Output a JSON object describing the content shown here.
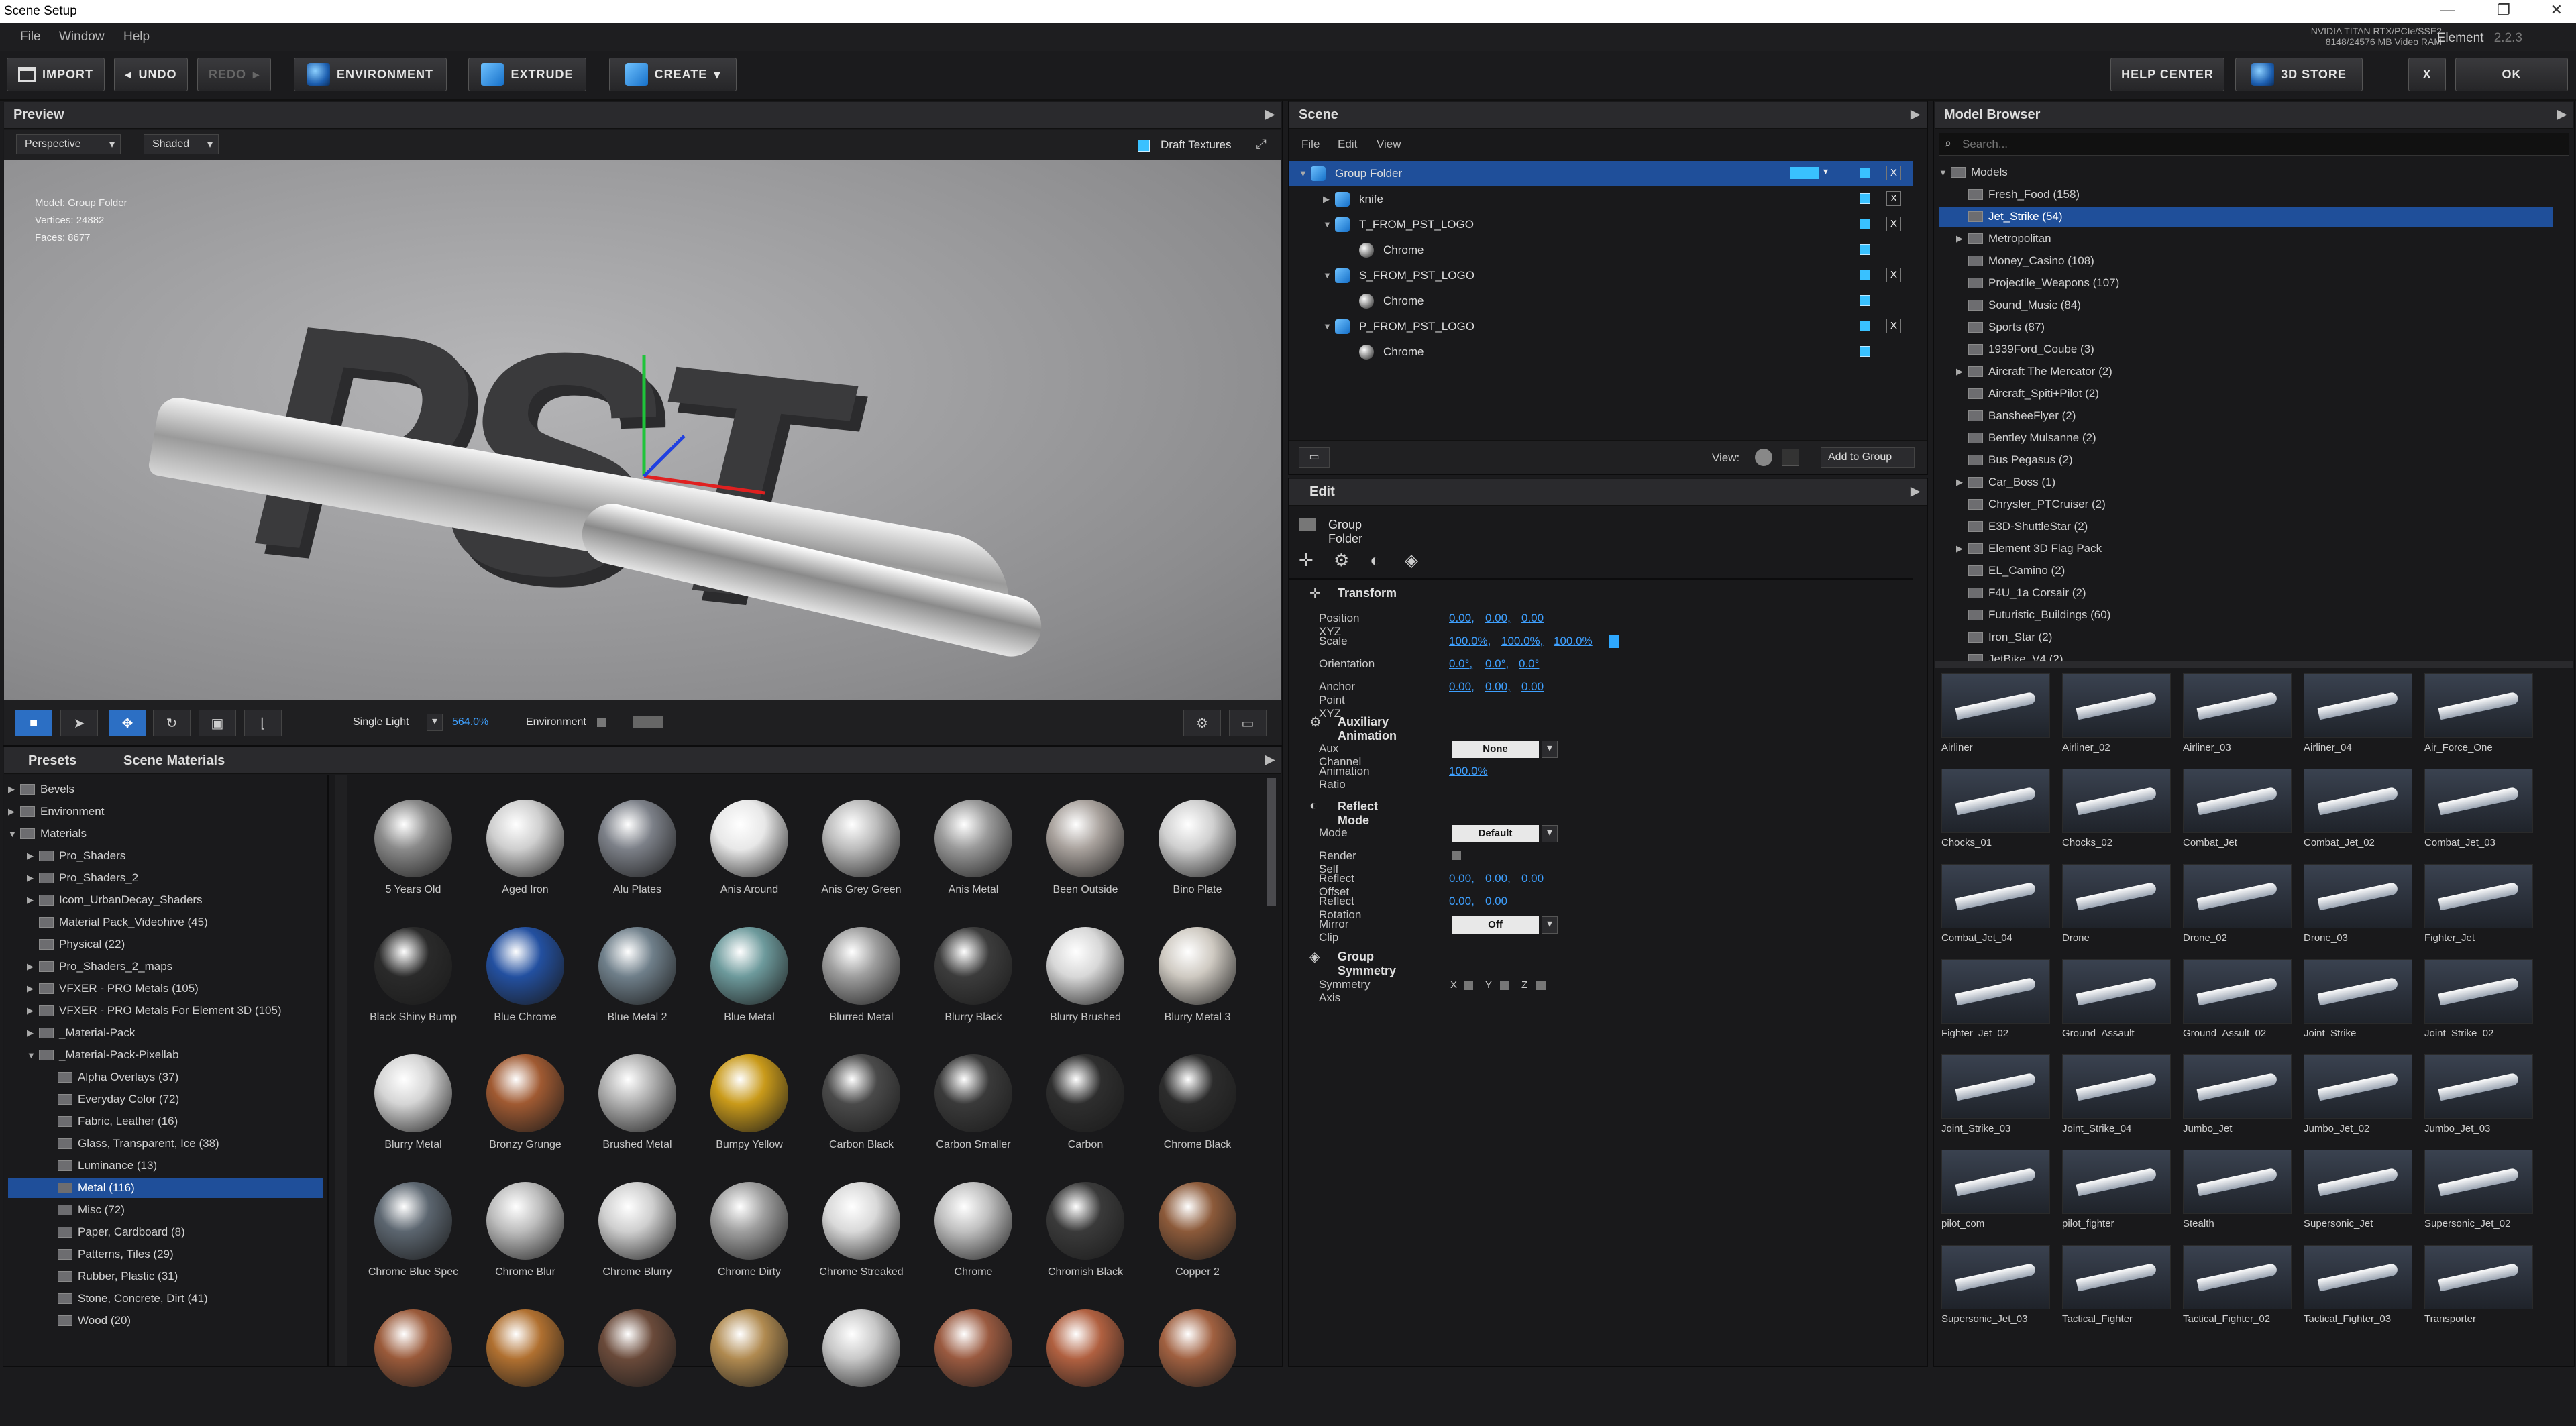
{
  "window": {
    "title": "Scene Setup",
    "min": "—",
    "restore": "❐",
    "close": "✕"
  },
  "menu": [
    "File",
    "Window",
    "Help"
  ],
  "gpu": {
    "line1": "NVIDIA TITAN RTX/PCIe/SSE2",
    "line2": "8148/24576 MB Video RAM"
  },
  "version": {
    "label": "Element",
    "number": "2.2.3"
  },
  "toolbar": {
    "import": "IMPORT",
    "undo": "UNDO",
    "redo": "REDO",
    "environment": "ENVIRONMENT",
    "extrude": "EXTRUDE",
    "create": "CREATE",
    "help": "HELP CENTER",
    "store": "3D STORE",
    "x": "X",
    "ok": "OK"
  },
  "preview": {
    "title": "Preview",
    "camera": "Perspective",
    "shading": "Shaded",
    "draft": "Draft Textures",
    "info": [
      "Model: Group Folder",
      "Vertices: 24882",
      "Faces: 8677"
    ],
    "word": "PST",
    "light": "Single Light",
    "light_pct": "564.0%",
    "environment": "Environment"
  },
  "presets": {
    "tab1": "Presets",
    "tab2": "Scene Materials",
    "tree": [
      {
        "label": "Bevels",
        "indent": 0,
        "tw": "▶"
      },
      {
        "label": "Environment",
        "indent": 0,
        "tw": "▶"
      },
      {
        "label": "Materials",
        "indent": 0,
        "tw": "▼"
      },
      {
        "label": "Pro_Shaders",
        "indent": 1,
        "tw": "▶"
      },
      {
        "label": "Pro_Shaders_2",
        "indent": 1,
        "tw": "▶"
      },
      {
        "label": "Icom_UrbanDecay_Shaders",
        "indent": 1,
        "tw": "▶"
      },
      {
        "label": "Material Pack_Videohive (45)",
        "indent": 1,
        "tw": ""
      },
      {
        "label": "Physical (22)",
        "indent": 1,
        "tw": ""
      },
      {
        "label": "Pro_Shaders_2_maps",
        "indent": 1,
        "tw": "▶"
      },
      {
        "label": "VFXER - PRO Metals (105)",
        "indent": 1,
        "tw": "▶"
      },
      {
        "label": "VFXER - PRO Metals For Element 3D (105)",
        "indent": 1,
        "tw": "▶"
      },
      {
        "label": "_Material-Pack",
        "indent": 1,
        "tw": "▶"
      },
      {
        "label": "_Material-Pack-Pixellab",
        "indent": 1,
        "tw": "▼"
      },
      {
        "label": "Alpha Overlays (37)",
        "indent": 2,
        "tw": ""
      },
      {
        "label": "Everyday Color (72)",
        "indent": 2,
        "tw": ""
      },
      {
        "label": "Fabric, Leather (16)",
        "indent": 2,
        "tw": ""
      },
      {
        "label": "Glass, Transparent, Ice (38)",
        "indent": 2,
        "tw": ""
      },
      {
        "label": "Luminance (13)",
        "indent": 2,
        "tw": ""
      },
      {
        "label": "Metal (116)",
        "indent": 2,
        "tw": "",
        "sel": true
      },
      {
        "label": "Misc (72)",
        "indent": 2,
        "tw": ""
      },
      {
        "label": "Paper, Cardboard (8)",
        "indent": 2,
        "tw": ""
      },
      {
        "label": "Patterns, Tiles (29)",
        "indent": 2,
        "tw": ""
      },
      {
        "label": "Rubber, Plastic (31)",
        "indent": 2,
        "tw": ""
      },
      {
        "label": "Stone, Concrete, Dirt (41)",
        "indent": 2,
        "tw": ""
      },
      {
        "label": "Wood (20)",
        "indent": 2,
        "tw": ""
      }
    ]
  },
  "materials": [
    {
      "n": "5 Years Old",
      "c": "#8a8a8a"
    },
    {
      "n": "Aged Iron",
      "c": "#cfcfcf"
    },
    {
      "n": "Alu Plates",
      "c": "#7c8088"
    },
    {
      "n": "Anis Around",
      "c": "#e8e8e8"
    },
    {
      "n": "Anis Grey Green",
      "c": "#bcbcbc"
    },
    {
      "n": "Anis Metal",
      "c": "#9a9a9a"
    },
    {
      "n": "Been Outside",
      "c": "#a9a29d"
    },
    {
      "n": "Bino Plate",
      "c": "#d0d0d0"
    },
    {
      "n": "Black Shiny Bump",
      "c": "#2a2a2a"
    },
    {
      "n": "Blue Chrome",
      "c": "#2350a0"
    },
    {
      "n": "Blue Metal 2",
      "c": "#6f7f8a"
    },
    {
      "n": "Blue Metal",
      "c": "#6d9a9c"
    },
    {
      "n": "Blurred Metal",
      "c": "#9e9e9e"
    },
    {
      "n": "Blurry Black",
      "c": "#3c3c3c"
    },
    {
      "n": "Blurry Brushed",
      "c": "#d8d8d8"
    },
    {
      "n": "Blurry Metal 3",
      "c": "#cfcac2"
    },
    {
      "n": "Blurry Metal",
      "c": "#d5d5d5"
    },
    {
      "n": "Bronzy Grunge",
      "c": "#a05a32"
    },
    {
      "n": "Brushed Metal",
      "c": "#b0b0b0"
    },
    {
      "n": "Bumpy Yellow",
      "c": "#c99a1a"
    },
    {
      "n": "Carbon Black",
      "c": "#4a4a4a"
    },
    {
      "n": "Carbon Smaller",
      "c": "#3a3a3a"
    },
    {
      "n": "Carbon",
      "c": "#2e2e2e"
    },
    {
      "n": "Chrome Black",
      "c": "#2c2c2c"
    },
    {
      "n": "Chrome Blue Spec",
      "c": "#5c6670"
    },
    {
      "n": "Chrome Blur",
      "c": "#bdbdbd"
    },
    {
      "n": "Chrome Blurry",
      "c": "#cfcfcf"
    },
    {
      "n": "Chrome Dirty",
      "c": "#9f9f9f"
    },
    {
      "n": "Chrome Streaked",
      "c": "#d9d9d9"
    },
    {
      "n": "Chrome",
      "c": "#c0c0c0"
    },
    {
      "n": "Chromish Black",
      "c": "#3a3a3a"
    },
    {
      "n": "Copper 2",
      "c": "#8c5a3a"
    },
    {
      "n": "",
      "c": "#9a5a3a"
    },
    {
      "n": "",
      "c": "#b07030"
    },
    {
      "n": "",
      "c": "#6a4a3a"
    },
    {
      "n": "",
      "c": "#b08a50"
    },
    {
      "n": "",
      "c": "#c8c8c8"
    },
    {
      "n": "",
      "c": "#9a5a40"
    },
    {
      "n": "",
      "c": "#b06040"
    },
    {
      "n": "",
      "c": "#a06040"
    }
  ],
  "scene": {
    "title": "Scene",
    "menu": [
      "File",
      "Edit",
      "View"
    ],
    "rows": [
      {
        "label": "Group Folder",
        "indent": 0,
        "tw": "▼",
        "sel": true,
        "x": true
      },
      {
        "label": "knife",
        "indent": 1,
        "tw": "▶",
        "x": true
      },
      {
        "label": "T_FROM_PST_LOGO",
        "indent": 1,
        "tw": "▼",
        "x": true
      },
      {
        "label": "Chrome",
        "indent": 2,
        "tw": "",
        "mat": true
      },
      {
        "label": "S_FROM_PST_LOGO",
        "indent": 1,
        "tw": "▼",
        "x": true
      },
      {
        "label": "Chrome",
        "indent": 2,
        "tw": "",
        "mat": true
      },
      {
        "label": "P_FROM_PST_LOGO",
        "indent": 1,
        "tw": "▼",
        "x": true
      },
      {
        "label": "Chrome",
        "indent": 2,
        "tw": "",
        "mat": true
      }
    ],
    "view": "View:",
    "add": "Add to Group"
  },
  "edit": {
    "title": "Edit",
    "folder": "Group Folder",
    "transform": "Transform",
    "pos": "Position XYZ",
    "pos_v": [
      "0.00,",
      "0.00,",
      "0.00"
    ],
    "scale": "Scale",
    "scale_v": [
      "100.0%,",
      "100.0%,",
      "100.0%"
    ],
    "orient": "Orientation",
    "orient_v": [
      "0.0°,",
      "0.0°,",
      "0.0°"
    ],
    "anchor": "Anchor Point XYZ",
    "anchor_v": [
      "0.00,",
      "0.00,",
      "0.00"
    ],
    "aux": "Auxiliary Animation",
    "auxch": "Aux Channel",
    "auxch_v": "None",
    "ratio": "Animation Ratio",
    "ratio_v": "100.0%",
    "reflect": "Reflect Mode",
    "mode": "Mode",
    "mode_v": "Default",
    "rself": "Render Self",
    "roff": "Reflect Offset",
    "roff_v": [
      "0.00,",
      "0.00,",
      "0.00"
    ],
    "rrot": "Reflect Rotation",
    "rrot_v": [
      "0.00,",
      "0.00"
    ],
    "mclip": "Mirror Clip",
    "mclip_v": "Off",
    "sym": "Group Symmetry",
    "axis": "Symmetry Axis",
    "axes": [
      "X",
      "Y",
      "Z"
    ]
  },
  "browser": {
    "title": "Model Browser",
    "search": "Search...",
    "tree": [
      {
        "label": "Models",
        "indent": 0,
        "tw": "▼"
      },
      {
        "label": "Fresh_Food (158)",
        "indent": 1,
        "tw": ""
      },
      {
        "label": "Jet_Strike (54)",
        "indent": 1,
        "tw": "",
        "sel": true
      },
      {
        "label": "Metropolitan",
        "indent": 1,
        "tw": "▶"
      },
      {
        "label": "Money_Casino (108)",
        "indent": 1,
        "tw": ""
      },
      {
        "label": "Projectile_Weapons (107)",
        "indent": 1,
        "tw": ""
      },
      {
        "label": "Sound_Music (84)",
        "indent": 1,
        "tw": ""
      },
      {
        "label": "Sports (87)",
        "indent": 1,
        "tw": ""
      },
      {
        "label": "1939Ford_Coube (3)",
        "indent": 1,
        "tw": ""
      },
      {
        "label": "Aircraft The Mercator (2)",
        "indent": 1,
        "tw": "▶"
      },
      {
        "label": "Aircraft_Spiti+Pilot (2)",
        "indent": 1,
        "tw": ""
      },
      {
        "label": "BansheeFlyer (2)",
        "indent": 1,
        "tw": ""
      },
      {
        "label": "Bentley Mulsanne (2)",
        "indent": 1,
        "tw": ""
      },
      {
        "label": "Bus Pegasus (2)",
        "indent": 1,
        "tw": ""
      },
      {
        "label": "Car_Boss (1)",
        "indent": 1,
        "tw": "▶"
      },
      {
        "label": "Chrysler_PTCruiser (2)",
        "indent": 1,
        "tw": ""
      },
      {
        "label": "E3D-ShuttleStar (2)",
        "indent": 1,
        "tw": ""
      },
      {
        "label": "Element 3D Flag Pack",
        "indent": 1,
        "tw": "▶"
      },
      {
        "label": "EL_Camino (2)",
        "indent": 1,
        "tw": ""
      },
      {
        "label": "F4U_1a Corsair (2)",
        "indent": 1,
        "tw": ""
      },
      {
        "label": "Futuristic_Buildings (60)",
        "indent": 1,
        "tw": ""
      },
      {
        "label": "Iron_Star (2)",
        "indent": 1,
        "tw": ""
      },
      {
        "label": "JetBike_V4 (2)",
        "indent": 1,
        "tw": ""
      }
    ],
    "models": [
      "Airliner",
      "Airliner_02",
      "Airliner_03",
      "Airliner_04",
      "Air_Force_One",
      "Chocks_01",
      "Chocks_02",
      "Combat_Jet",
      "Combat_Jet_02",
      "Combat_Jet_03",
      "Combat_Jet_04",
      "Drone",
      "Drone_02",
      "Drone_03",
      "Fighter_Jet",
      "Fighter_Jet_02",
      "Ground_Assault",
      "Ground_Assult_02",
      "Joint_Strike",
      "Joint_Strike_02",
      "Joint_Strike_03",
      "Joint_Strike_04",
      "Jumbo_Jet",
      "Jumbo_Jet_02",
      "Jumbo_Jet_03",
      "pilot_com",
      "pilot_fighter",
      "Stealth",
      "Supersonic_Jet",
      "Supersonic_Jet_02",
      "Supersonic_Jet_03",
      "Tactical_Fighter",
      "Tactical_Fighter_02",
      "Tactical_Fighter_03",
      "Transporter"
    ]
  }
}
